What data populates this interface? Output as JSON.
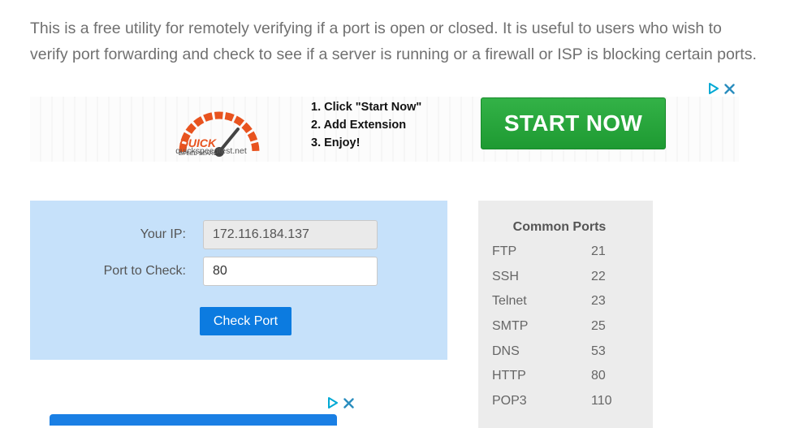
{
  "intro": {
    "text": "This is a free utility for remotely verifying if a port is open or closed. It is useful to users who wish to verify port forwarding and check to see if a server is running or a firewall or ISP is blocking certain ports."
  },
  "ad": {
    "logo_text": "QUICK",
    "logo_subtext": "SPEED SEARCH",
    "site": "quickspeedtest.net",
    "steps": [
      "1. Click \"Start Now\"",
      "2. Add Extension",
      "3. Enjoy!"
    ],
    "cta": "START NOW",
    "ad_choices_icon": "ad-choices-play-icon",
    "close_icon": "close-x-icon"
  },
  "form": {
    "ip_label": "Your IP:",
    "ip_value": "172.116.184.137",
    "port_label": "Port to Check:",
    "port_value": "80",
    "submit_label": "Check Port"
  },
  "common_ports": {
    "title": "Common Ports",
    "rows": [
      {
        "name": "FTP",
        "port": "21"
      },
      {
        "name": "SSH",
        "port": "22"
      },
      {
        "name": "Telnet",
        "port": "23"
      },
      {
        "name": "SMTP",
        "port": "25"
      },
      {
        "name": "DNS",
        "port": "53"
      },
      {
        "name": "HTTP",
        "port": "80"
      },
      {
        "name": "POP3",
        "port": "110"
      }
    ]
  },
  "colors": {
    "form_bg": "#c6e1fa",
    "ports_bg": "#ececec",
    "button_blue": "#0c7be0",
    "ad_green": "#1e9a32",
    "logo_orange": "#e8531f"
  }
}
